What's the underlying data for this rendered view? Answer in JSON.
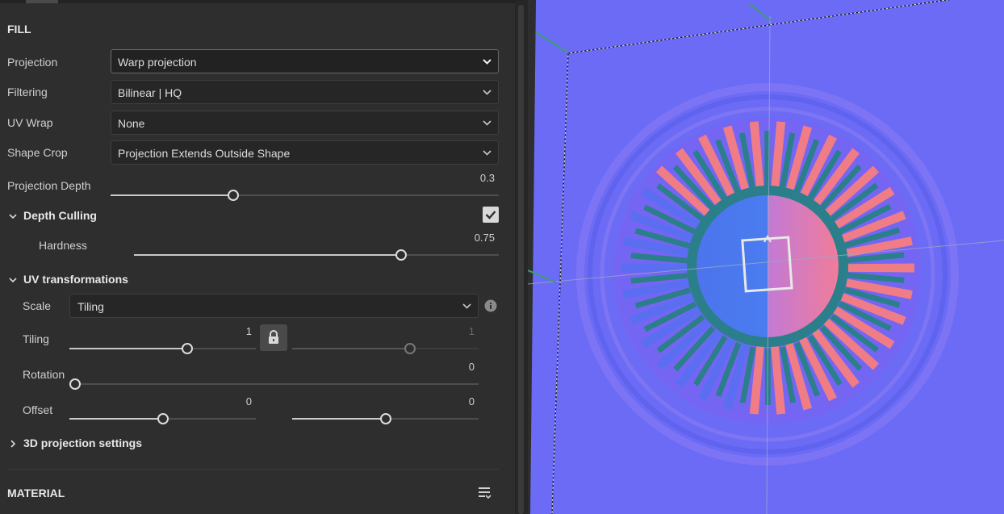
{
  "fill": {
    "section_title": "FILL",
    "projection": {
      "label": "Projection",
      "value": "Warp projection"
    },
    "filtering": {
      "label": "Filtering",
      "value": "Bilinear | HQ"
    },
    "uv_wrap": {
      "label": "UV Wrap",
      "value": "None"
    },
    "shape_crop": {
      "label": "Shape Crop",
      "value": "Projection Extends Outside Shape"
    },
    "projection_depth": {
      "label": "Projection Depth",
      "value": "0.3",
      "fraction": 0.31
    },
    "depth_culling": {
      "title": "Depth Culling",
      "checked": true
    },
    "hardness": {
      "label": "Hardness",
      "value": "0.75",
      "fraction": 0.74
    }
  },
  "uv_transformations": {
    "title": "UV transformations",
    "scale": {
      "label": "Scale",
      "value": "Tiling"
    },
    "tiling": {
      "label": "Tiling",
      "value_u": "1",
      "value_v": "1",
      "fraction_u": 0.64,
      "fraction_v": 0.64
    },
    "rotation": {
      "label": "Rotation",
      "value": "0",
      "fraction": 0.0
    },
    "offset": {
      "label": "Offset",
      "value_u": "0",
      "value_v": "0",
      "fraction_u": 0.5,
      "fraction_v": 0.5
    }
  },
  "projection_3d": {
    "title": "3D projection settings"
  },
  "material": {
    "section_title": "MATERIAL"
  },
  "icons": [
    "chevron-down-icon",
    "chevron-right-icon",
    "checkbox-icon",
    "lock-icon",
    "info-icon",
    "list-menu-icon"
  ],
  "colors": {
    "panel": "#2e2e2e",
    "viewport": "#6b6bf6",
    "salmon": "#f07c86",
    "teal": "#2a7f8a"
  }
}
